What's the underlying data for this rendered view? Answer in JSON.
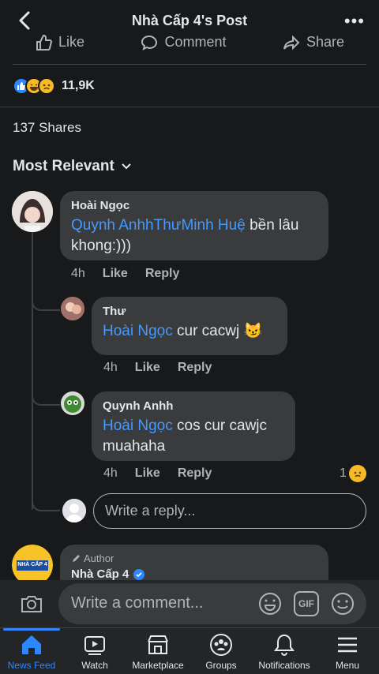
{
  "header": {
    "title": "Nhà Cấp 4's Post"
  },
  "actions": {
    "like": "Like",
    "comment": "Comment",
    "share": "Share"
  },
  "reactions": {
    "count": "11,9K",
    "types": [
      "like-icon",
      "haha-icon",
      "sad-icon"
    ]
  },
  "shares": "137 Shares",
  "sort": {
    "label": "Most Relevant"
  },
  "comments": [
    {
      "author": "Hoài Ngọc",
      "mentions": "Quynh AnhhThưMinh Huệ",
      "text": " bền lâu khong:)))",
      "time": "4h",
      "like": "Like",
      "reply": "Reply"
    },
    {
      "author": "Thư",
      "mentions": "Hoài Ngọc",
      "text": " cur cacwj",
      "time": "4h",
      "like": "Like",
      "reply": "Reply"
    },
    {
      "author": "Quynh Anhh",
      "mentions": "Hoài Ngọc",
      "text": " cos cur cawjc muahaha",
      "time": "4h",
      "like": "Like",
      "reply": "Reply",
      "reaction_count": "1"
    }
  ],
  "reply_placeholder": "Write a reply...",
  "author_comment": {
    "tag": "Author",
    "name": "Nhà Cấp 4",
    "avatar_text": "NHÀ CẤP 4"
  },
  "composer": {
    "placeholder": "Write a comment...",
    "gif": "GIF"
  },
  "tabs": [
    {
      "label": "News Feed",
      "active": true
    },
    {
      "label": "Watch"
    },
    {
      "label": "Marketplace"
    },
    {
      "label": "Groups"
    },
    {
      "label": "Notifications"
    },
    {
      "label": "Menu"
    }
  ],
  "colors": {
    "accent": "#2d88ff",
    "mention": "#4599ff",
    "background": "#18191a",
    "bubble": "#3a3b3c"
  }
}
